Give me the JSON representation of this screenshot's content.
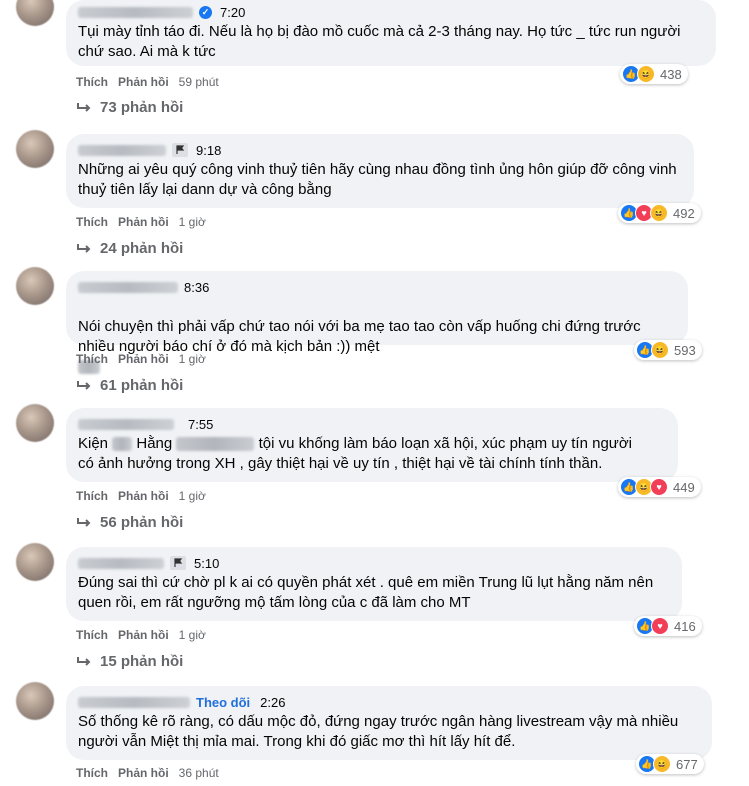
{
  "comments": [
    {
      "time": "7:20",
      "text": "Tụi mày tỉnh táo đi. Nếu là họ bị đào mồ cuốc mà cả 2-3 tháng nay. Họ tức _ tức run người chứ sao. Ai mà k tức",
      "like": "Thích",
      "reply": "Phản hồi",
      "age": "59 phút",
      "reactions": "438",
      "replies": "73 phản hồi"
    },
    {
      "time": "9:18",
      "text": "Những ai yêu quý công vinh thuỷ tiên hãy cùng nhau đồng tình ủng hôn giúp đỡ công vinh thuỷ tiên lấy lại dann dự và công bằng",
      "like": "Thích",
      "reply": "Phản hồi",
      "age": "1 giờ",
      "reactions": "492",
      "replies": "24 phản hồi"
    },
    {
      "time": "8:36",
      "text_a": "Nói chuyện thì phải vấp chứ tao nói với ba mẹ tao tao còn vấp huống chi đứng trước nhiều người báo chí ở đó mà kịch bản :)) mệt",
      "like": "Thích",
      "reply": "Phản hồi",
      "age": "1 giờ",
      "reactions": "593",
      "replies": "61 phản hồi"
    },
    {
      "time": "7:55",
      "text_a": "Kiện",
      "text_b": "Hằng",
      "text_c": "tội vu khống làm báo loạn xã hội, xúc phạm uy tín người",
      "text_d": "có ảnh hưởng trong XH , gây thiệt hại về uy tín , thiệt hại về tài chính tính thần.",
      "like": "Thích",
      "reply": "Phản hồi",
      "age": "1 giờ",
      "reactions": "449",
      "replies": "56 phản hồi"
    },
    {
      "time": "5:10",
      "text": "Đúng sai thì cứ chờ pl k ai có quyền phát xét . quê em miền Trung lũ lụt hằng năm nên quen rồi, em rất ngưỡng mộ tấm lòng của c đã làm cho MT",
      "like": "Thích",
      "reply": "Phản hồi",
      "age": "1 giờ",
      "reactions": "416",
      "replies": "15 phản hồi"
    },
    {
      "follow": "Theo dõi",
      "time": "2:26",
      "text": "Số thống kê rõ ràng, có dấu mộc đỏ, đứng ngay trước ngân hàng livestream vậy mà nhiều người vẫn Miệt thị mỉa mai. Trong khi đó giấc mơ thì hít lấy hít để.",
      "like": "Thích",
      "reply": "Phản hồi",
      "age": "36 phút",
      "reactions": "677"
    }
  ],
  "icons": {
    "like": "like-reaction-icon",
    "haha": "haha-reaction-icon",
    "love": "love-reaction-icon",
    "verified": "verified-badge-icon",
    "flag": "flag-icon",
    "reply_arrow": "reply-arrow-icon"
  },
  "colors": {
    "bubble": "#f0f2f5",
    "like": "#1877f2",
    "love": "#f33e58",
    "haha": "#f7b928",
    "muted": "#65676b"
  }
}
